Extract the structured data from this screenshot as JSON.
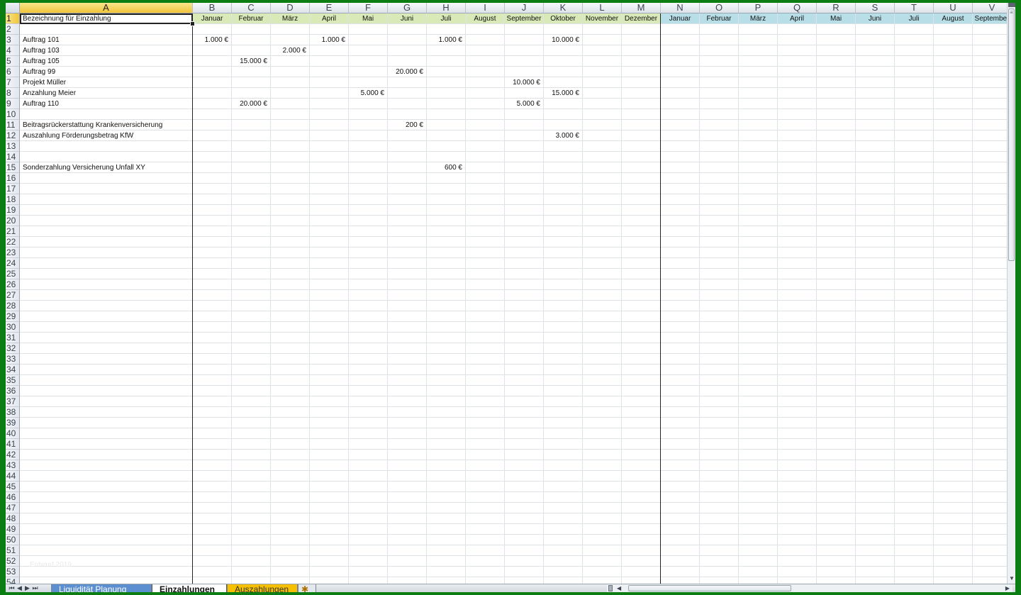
{
  "columns": [
    {
      "letter": "A"
    },
    {
      "letter": "B"
    },
    {
      "letter": "C"
    },
    {
      "letter": "D"
    },
    {
      "letter": "E"
    },
    {
      "letter": "F"
    },
    {
      "letter": "G"
    },
    {
      "letter": "H"
    },
    {
      "letter": "I"
    },
    {
      "letter": "J"
    },
    {
      "letter": "K"
    },
    {
      "letter": "L"
    },
    {
      "letter": "M"
    },
    {
      "letter": "N"
    },
    {
      "letter": "O"
    },
    {
      "letter": "P"
    },
    {
      "letter": "Q"
    },
    {
      "letter": "R"
    },
    {
      "letter": "S"
    },
    {
      "letter": "T"
    },
    {
      "letter": "U"
    },
    {
      "letter": "V"
    }
  ],
  "active_cell": "A1",
  "header": {
    "a1": "Bezeichnung für Einzahlung",
    "months_green": [
      "Januar",
      "Februar",
      "März",
      "April",
      "Mai",
      "Juni",
      "Juli",
      "August",
      "September",
      "Oktober",
      "November",
      "Dezember"
    ],
    "months_blue": [
      "Januar",
      "Februar",
      "März",
      "April",
      "Mai",
      "Juni",
      "Juli",
      "August",
      "September"
    ]
  },
  "row_count": 54,
  "rows": [
    {
      "row": 3,
      "label": "Auftrag 101",
      "values": {
        "B": "1.000 €",
        "E": "1.000 €",
        "H": "1.000 €",
        "K": "10.000 €"
      }
    },
    {
      "row": 4,
      "label": "Auftrag 103",
      "values": {
        "D": "2.000 €"
      }
    },
    {
      "row": 5,
      "label": "Auftrag 105",
      "values": {
        "C": "15.000 €"
      }
    },
    {
      "row": 6,
      "label": "Auftrag 99",
      "values": {
        "G": "20.000 €"
      }
    },
    {
      "row": 7,
      "label": "Projekt Müller",
      "values": {
        "J": "10.000 €"
      }
    },
    {
      "row": 8,
      "label": "Anzahlung Meier",
      "values": {
        "F": "5.000 €",
        "K": "15.000 €"
      }
    },
    {
      "row": 9,
      "label": "Auftrag 110",
      "values": {
        "C": "20.000 €",
        "J": "5.000 €"
      }
    },
    {
      "row": 11,
      "label": "Beitragsrückerstattung Krankenversicherung",
      "values": {
        "G": "200 €"
      }
    },
    {
      "row": 12,
      "label": "Auszahlung Förderungsbetrag KfW",
      "values": {
        "K": "3.000 €"
      }
    },
    {
      "row": 15,
      "label": "Sonderzahlung Versicherung Unfall XY",
      "values": {
        "H": "600 €"
      }
    }
  ],
  "watermark": "Entwurf 2019",
  "tabs": [
    {
      "label": "Liquidität Planung",
      "style": "blue"
    },
    {
      "label": "Einzahlungen",
      "style": "active"
    },
    {
      "label": "Auszahlungen",
      "style": "orange"
    },
    {
      "label": "✱",
      "style": "add"
    }
  ],
  "colors": {
    "frame": "#0c7d12",
    "header_green": "#d9e9b8",
    "header_blue": "#b8dfe8",
    "selected_header": "#f1c43a",
    "tab_blue": "#5b8fcf",
    "tab_orange": "#f6c000"
  }
}
